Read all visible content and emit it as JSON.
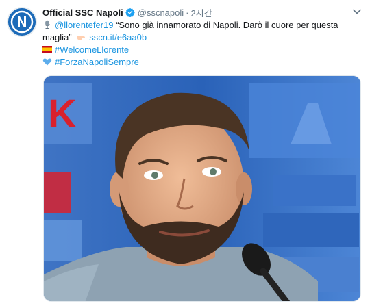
{
  "account": {
    "display_name": "Official SSC Napoli",
    "handle": "@sscnapoli",
    "separator": "·",
    "time": "2시간"
  },
  "tweet": {
    "mention": "@llorentefer19",
    "quote_line1": " “Sono già innamorato di Napoli. Darò il cuore per questa",
    "quote_line2": "maglia”",
    "link": "sscn.it/e6aa0b",
    "hashtag1": "#WelcomeLlorente",
    "hashtag2": "#ForzaNapoliSempre"
  },
  "colors": {
    "link": "#1b95e0",
    "verified": "#1da1f2",
    "text": "#14171a",
    "muted": "#657786",
    "napoli_blue": "#1d6bb8"
  },
  "icons": {
    "microphone": "studio-microphone-emoji",
    "pointing": "backhand-index-pointing-right-emoji",
    "flag": "flag-spain-emoji",
    "heart": "blue-heart-emoji",
    "verified": "verified-badge-icon",
    "caret": "chevron-down-icon"
  },
  "media": {
    "backdrop_text": "K"
  }
}
